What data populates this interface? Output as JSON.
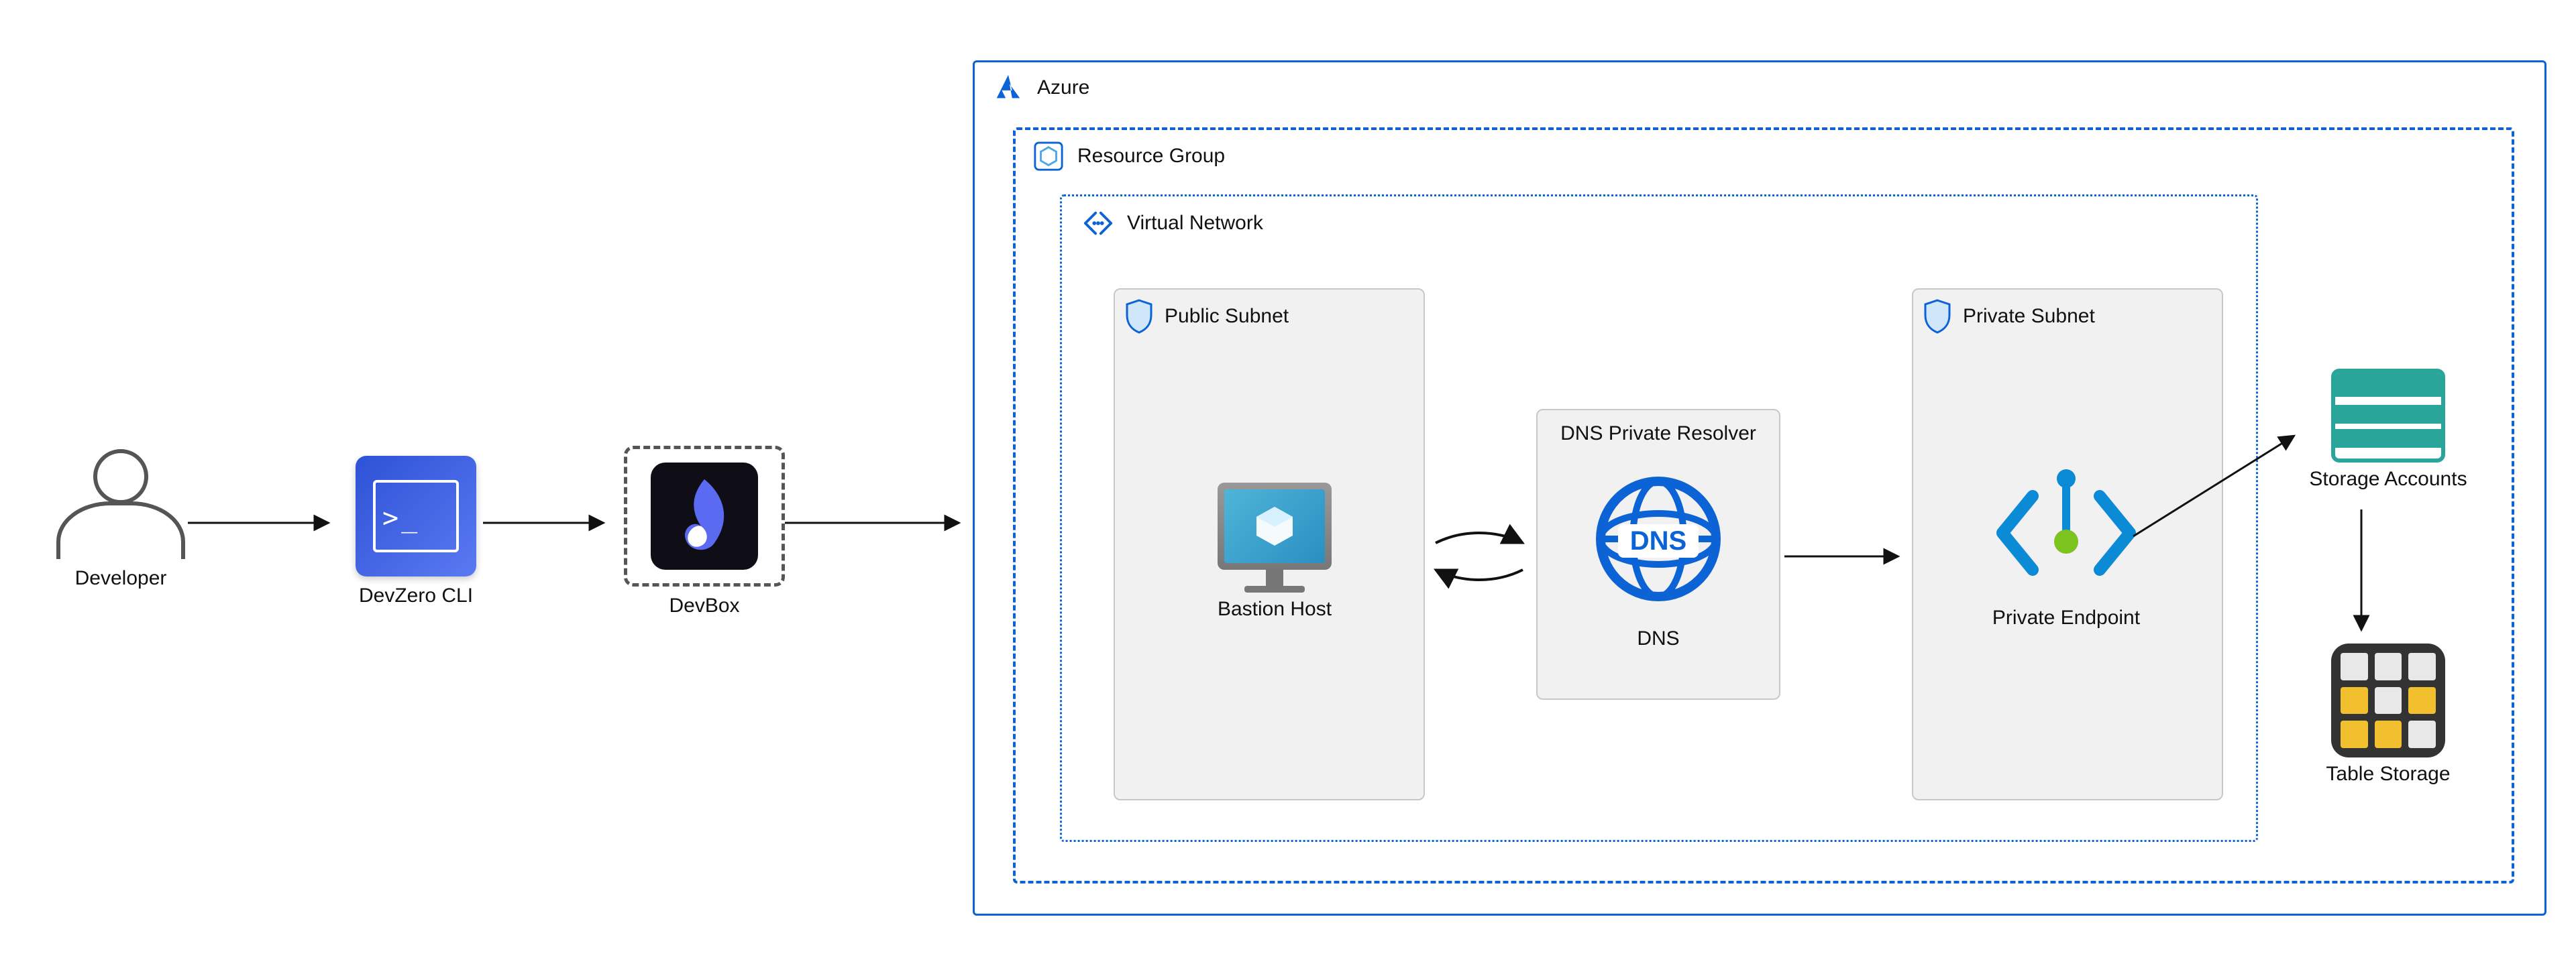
{
  "developer": {
    "label": "Developer"
  },
  "cli": {
    "label": "DevZero CLI"
  },
  "devbox": {
    "label": "DevBox"
  },
  "azure": {
    "label": "Azure",
    "color_border": "#0b63d6"
  },
  "resource_group": {
    "label": "Resource Group"
  },
  "virtual_network": {
    "label": "Virtual Network"
  },
  "public_subnet": {
    "label": "Public Subnet",
    "bastion_label": "Bastion Host"
  },
  "dns_resolver": {
    "title": "DNS Private Resolver",
    "icon_label": "DNS",
    "caption": "DNS"
  },
  "private_subnet": {
    "label": "Private Subnet",
    "endpoint_label": "Private Endpoint"
  },
  "storage_accounts": {
    "label": "Storage Accounts"
  },
  "table_storage": {
    "label": "Table Storage"
  },
  "flow": [
    "Developer → DevZero CLI",
    "DevZero CLI → DevBox",
    "DevBox → Azure boundary",
    "Bastion Host ↔ DNS Private Resolver",
    "DNS Private Resolver → Private Endpoint",
    "Private Endpoint → Storage Accounts",
    "Storage Accounts → Table Storage"
  ]
}
